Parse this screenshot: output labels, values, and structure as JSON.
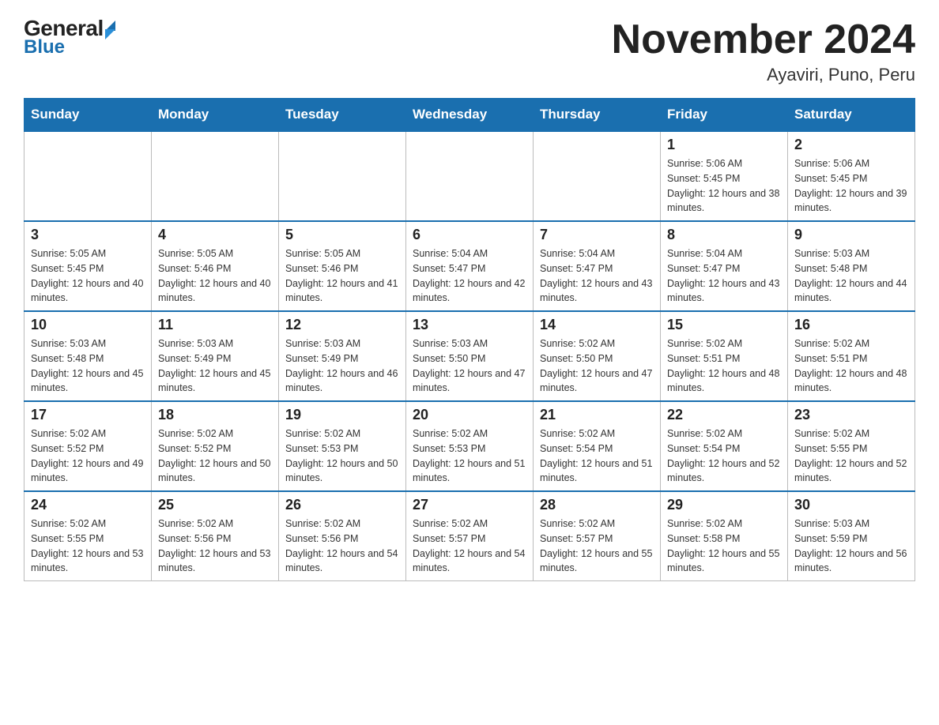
{
  "header": {
    "logo_general": "General",
    "logo_blue": "Blue",
    "month_title": "November 2024",
    "subtitle": "Ayaviri, Puno, Peru"
  },
  "days_of_week": [
    "Sunday",
    "Monday",
    "Tuesday",
    "Wednesday",
    "Thursday",
    "Friday",
    "Saturday"
  ],
  "weeks": [
    [
      {
        "day": "",
        "sunrise": "",
        "sunset": "",
        "daylight": ""
      },
      {
        "day": "",
        "sunrise": "",
        "sunset": "",
        "daylight": ""
      },
      {
        "day": "",
        "sunrise": "",
        "sunset": "",
        "daylight": ""
      },
      {
        "day": "",
        "sunrise": "",
        "sunset": "",
        "daylight": ""
      },
      {
        "day": "",
        "sunrise": "",
        "sunset": "",
        "daylight": ""
      },
      {
        "day": "1",
        "sunrise": "Sunrise: 5:06 AM",
        "sunset": "Sunset: 5:45 PM",
        "daylight": "Daylight: 12 hours and 38 minutes."
      },
      {
        "day": "2",
        "sunrise": "Sunrise: 5:06 AM",
        "sunset": "Sunset: 5:45 PM",
        "daylight": "Daylight: 12 hours and 39 minutes."
      }
    ],
    [
      {
        "day": "3",
        "sunrise": "Sunrise: 5:05 AM",
        "sunset": "Sunset: 5:45 PM",
        "daylight": "Daylight: 12 hours and 40 minutes."
      },
      {
        "day": "4",
        "sunrise": "Sunrise: 5:05 AM",
        "sunset": "Sunset: 5:46 PM",
        "daylight": "Daylight: 12 hours and 40 minutes."
      },
      {
        "day": "5",
        "sunrise": "Sunrise: 5:05 AM",
        "sunset": "Sunset: 5:46 PM",
        "daylight": "Daylight: 12 hours and 41 minutes."
      },
      {
        "day": "6",
        "sunrise": "Sunrise: 5:04 AM",
        "sunset": "Sunset: 5:47 PM",
        "daylight": "Daylight: 12 hours and 42 minutes."
      },
      {
        "day": "7",
        "sunrise": "Sunrise: 5:04 AM",
        "sunset": "Sunset: 5:47 PM",
        "daylight": "Daylight: 12 hours and 43 minutes."
      },
      {
        "day": "8",
        "sunrise": "Sunrise: 5:04 AM",
        "sunset": "Sunset: 5:47 PM",
        "daylight": "Daylight: 12 hours and 43 minutes."
      },
      {
        "day": "9",
        "sunrise": "Sunrise: 5:03 AM",
        "sunset": "Sunset: 5:48 PM",
        "daylight": "Daylight: 12 hours and 44 minutes."
      }
    ],
    [
      {
        "day": "10",
        "sunrise": "Sunrise: 5:03 AM",
        "sunset": "Sunset: 5:48 PM",
        "daylight": "Daylight: 12 hours and 45 minutes."
      },
      {
        "day": "11",
        "sunrise": "Sunrise: 5:03 AM",
        "sunset": "Sunset: 5:49 PM",
        "daylight": "Daylight: 12 hours and 45 minutes."
      },
      {
        "day": "12",
        "sunrise": "Sunrise: 5:03 AM",
        "sunset": "Sunset: 5:49 PM",
        "daylight": "Daylight: 12 hours and 46 minutes."
      },
      {
        "day": "13",
        "sunrise": "Sunrise: 5:03 AM",
        "sunset": "Sunset: 5:50 PM",
        "daylight": "Daylight: 12 hours and 47 minutes."
      },
      {
        "day": "14",
        "sunrise": "Sunrise: 5:02 AM",
        "sunset": "Sunset: 5:50 PM",
        "daylight": "Daylight: 12 hours and 47 minutes."
      },
      {
        "day": "15",
        "sunrise": "Sunrise: 5:02 AM",
        "sunset": "Sunset: 5:51 PM",
        "daylight": "Daylight: 12 hours and 48 minutes."
      },
      {
        "day": "16",
        "sunrise": "Sunrise: 5:02 AM",
        "sunset": "Sunset: 5:51 PM",
        "daylight": "Daylight: 12 hours and 48 minutes."
      }
    ],
    [
      {
        "day": "17",
        "sunrise": "Sunrise: 5:02 AM",
        "sunset": "Sunset: 5:52 PM",
        "daylight": "Daylight: 12 hours and 49 minutes."
      },
      {
        "day": "18",
        "sunrise": "Sunrise: 5:02 AM",
        "sunset": "Sunset: 5:52 PM",
        "daylight": "Daylight: 12 hours and 50 minutes."
      },
      {
        "day": "19",
        "sunrise": "Sunrise: 5:02 AM",
        "sunset": "Sunset: 5:53 PM",
        "daylight": "Daylight: 12 hours and 50 minutes."
      },
      {
        "day": "20",
        "sunrise": "Sunrise: 5:02 AM",
        "sunset": "Sunset: 5:53 PM",
        "daylight": "Daylight: 12 hours and 51 minutes."
      },
      {
        "day": "21",
        "sunrise": "Sunrise: 5:02 AM",
        "sunset": "Sunset: 5:54 PM",
        "daylight": "Daylight: 12 hours and 51 minutes."
      },
      {
        "day": "22",
        "sunrise": "Sunrise: 5:02 AM",
        "sunset": "Sunset: 5:54 PM",
        "daylight": "Daylight: 12 hours and 52 minutes."
      },
      {
        "day": "23",
        "sunrise": "Sunrise: 5:02 AM",
        "sunset": "Sunset: 5:55 PM",
        "daylight": "Daylight: 12 hours and 52 minutes."
      }
    ],
    [
      {
        "day": "24",
        "sunrise": "Sunrise: 5:02 AM",
        "sunset": "Sunset: 5:55 PM",
        "daylight": "Daylight: 12 hours and 53 minutes."
      },
      {
        "day": "25",
        "sunrise": "Sunrise: 5:02 AM",
        "sunset": "Sunset: 5:56 PM",
        "daylight": "Daylight: 12 hours and 53 minutes."
      },
      {
        "day": "26",
        "sunrise": "Sunrise: 5:02 AM",
        "sunset": "Sunset: 5:56 PM",
        "daylight": "Daylight: 12 hours and 54 minutes."
      },
      {
        "day": "27",
        "sunrise": "Sunrise: 5:02 AM",
        "sunset": "Sunset: 5:57 PM",
        "daylight": "Daylight: 12 hours and 54 minutes."
      },
      {
        "day": "28",
        "sunrise": "Sunrise: 5:02 AM",
        "sunset": "Sunset: 5:57 PM",
        "daylight": "Daylight: 12 hours and 55 minutes."
      },
      {
        "day": "29",
        "sunrise": "Sunrise: 5:02 AM",
        "sunset": "Sunset: 5:58 PM",
        "daylight": "Daylight: 12 hours and 55 minutes."
      },
      {
        "day": "30",
        "sunrise": "Sunrise: 5:03 AM",
        "sunset": "Sunset: 5:59 PM",
        "daylight": "Daylight: 12 hours and 56 minutes."
      }
    ]
  ]
}
